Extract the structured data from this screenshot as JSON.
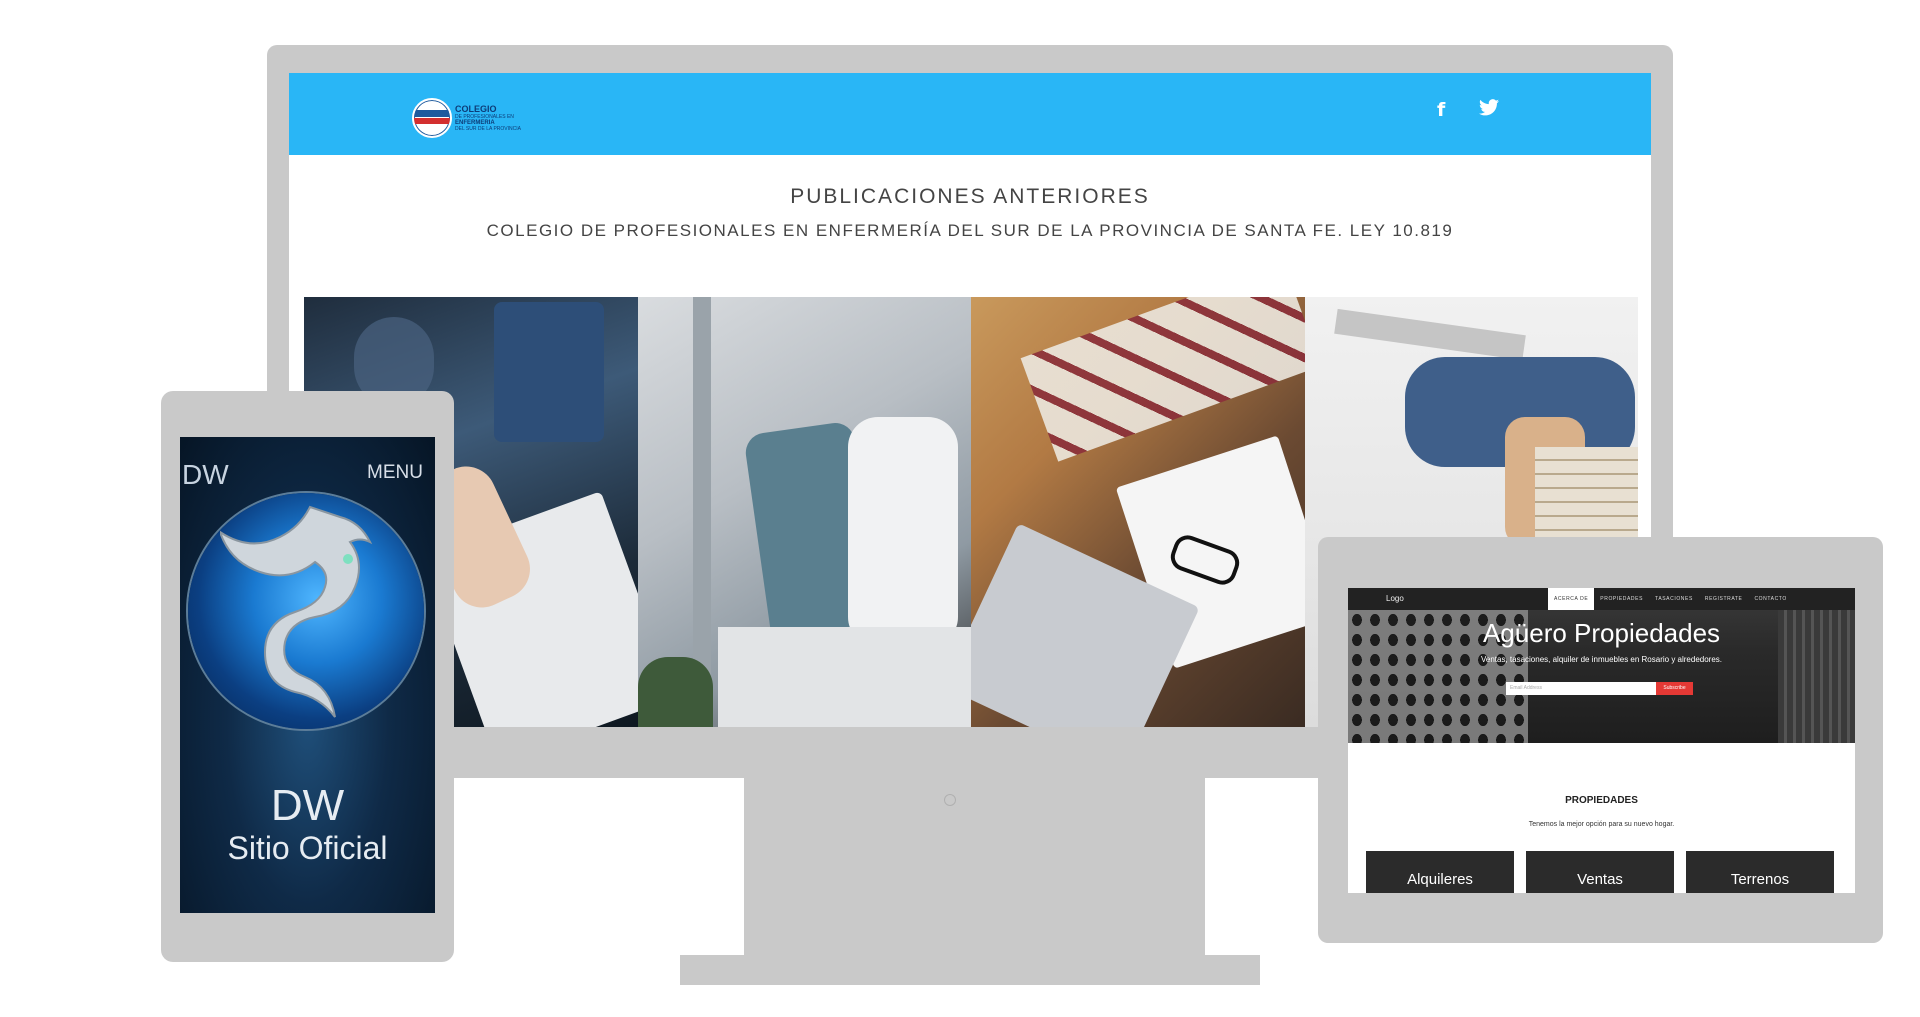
{
  "monitor": {
    "site": {
      "logo": {
        "line1": "COLEGIO",
        "line2": "DE PROFESIONALES EN",
        "line3": "ENFERMERIA",
        "line4": "DEL SUR DE LA PROVINCIA"
      },
      "social": [
        {
          "name": "facebook",
          "glyph": "f"
        },
        {
          "name": "twitter",
          "glyph": "🐦"
        }
      ],
      "header_color": "#29b6f6",
      "title": "PUBLICACIONES ANTERIORES",
      "subtitle": "COLEGIO DE PROFESIONALES EN ENFERMERÍA DEL SUR DE LA PROVINCIA DE SANTA FE. LEY 10.819",
      "gallery": [
        "notebook-writing-photo",
        "clothes-chair-photo",
        "laptop-glasses-desk-photo",
        "reading-books-photo"
      ]
    }
  },
  "phone": {
    "brand": "DW",
    "menu": "MENU",
    "title": "DW",
    "subtitle": "Sitio Oficial"
  },
  "tablet": {
    "nav": {
      "logo": "Logo",
      "links": [
        "ACERCA DE",
        "PROPIEDADES",
        "TASACIONES",
        "REGISTRATE",
        "CONTACTO"
      ]
    },
    "hero": {
      "title": "Agüero Propiedades",
      "description": "Ventas, tasaciones, alquiler de inmuebles en Rosario y alrededores.",
      "email_placeholder": "Email Address",
      "subscribe": "Subscribe"
    },
    "section": {
      "title": "PROPIEDADES",
      "subtitle": "Tenemos la mejor opción para su nuevo hogar."
    },
    "cards": [
      "Alquileres",
      "Ventas",
      "Terrenos"
    ],
    "accent_color": "#e53935"
  }
}
